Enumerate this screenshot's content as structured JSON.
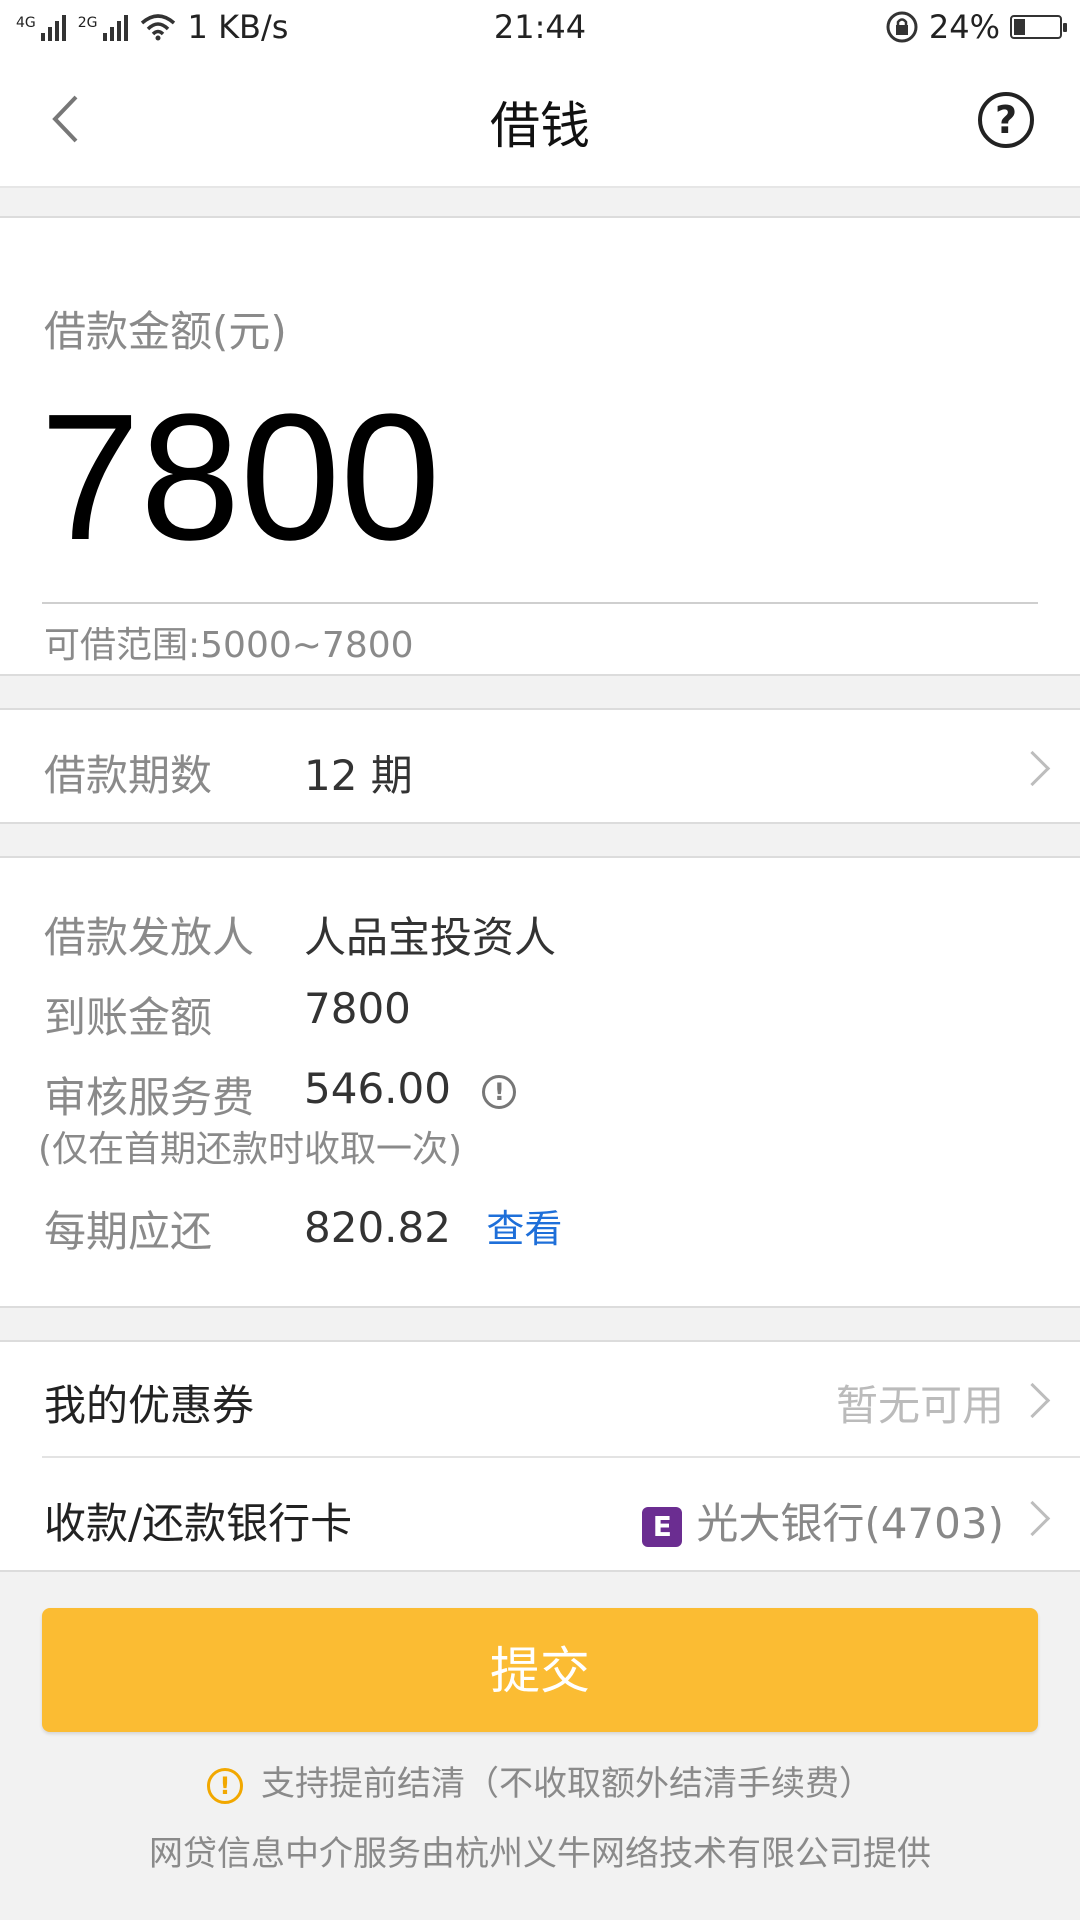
{
  "status_bar": {
    "network_1": "4G",
    "network_2": "2G",
    "speed": "1 KB/s",
    "time": "21:44",
    "battery": "24%",
    "battery_level": 0.24
  },
  "header": {
    "title": "借钱",
    "back_icon": "chevron-left-icon",
    "help_icon": "question-circle-icon",
    "help_glyph": "?"
  },
  "amount": {
    "label": "借款金额(元)",
    "value": "7800",
    "range": "可借范围:5000~7800"
  },
  "term": {
    "label": "借款期数",
    "value": "12 期"
  },
  "details": {
    "lender_label": "借款发放人",
    "lender_value": "人品宝投资人",
    "received_label": "到账金额",
    "received_value": "7800",
    "fee_label": "审核服务费",
    "fee_value": "546.00",
    "fee_info_icon": "info-circle-icon",
    "fee_info_glyph": "!",
    "fee_note": "(仅在首期还款时收取一次)",
    "installment_label": "每期应还",
    "installment_value": "820.82",
    "view_link": "查看"
  },
  "coupon": {
    "label": "我的优惠券",
    "value": "暂无可用"
  },
  "bank": {
    "label": "收款/还款银行卡",
    "value": "光大银行(4703)",
    "icon_glyph": "E",
    "icon_color": "#6b2d91"
  },
  "submit": {
    "label": "提交",
    "color": "#fbbc33"
  },
  "notice": {
    "icon": "warning-circle-icon",
    "icon_glyph": "!",
    "text": "支持提前结清（不收取额外结清手续费）"
  },
  "footer": {
    "text": "网贷信息中介服务由杭州义牛网络技术有限公司提供"
  }
}
